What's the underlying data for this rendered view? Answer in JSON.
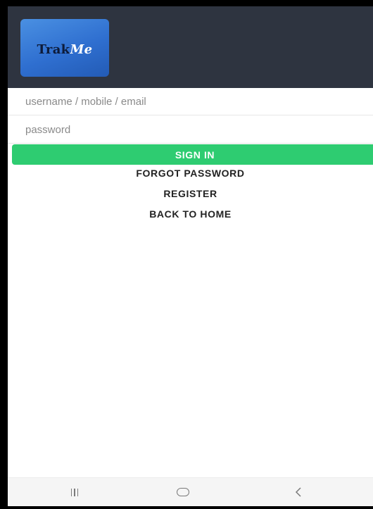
{
  "header": {
    "logo_prefix": "Trak",
    "logo_suffix": "Me"
  },
  "form": {
    "username_placeholder": "username / mobile / email",
    "password_placeholder": "password",
    "signin_label": "SIGN IN"
  },
  "links": {
    "forgot_password": "FORGOT PASSWORD",
    "register": "REGISTER",
    "back_to_home": "BACK TO HOME"
  },
  "navbar": {
    "recents_icon": "recents-icon",
    "home_icon": "home-icon",
    "back_icon": "back-icon",
    "back_glyph": "<"
  },
  "colors": {
    "appbar": "#2e3440",
    "logo": "#2f6fd0",
    "signin": "#2ecc71"
  }
}
